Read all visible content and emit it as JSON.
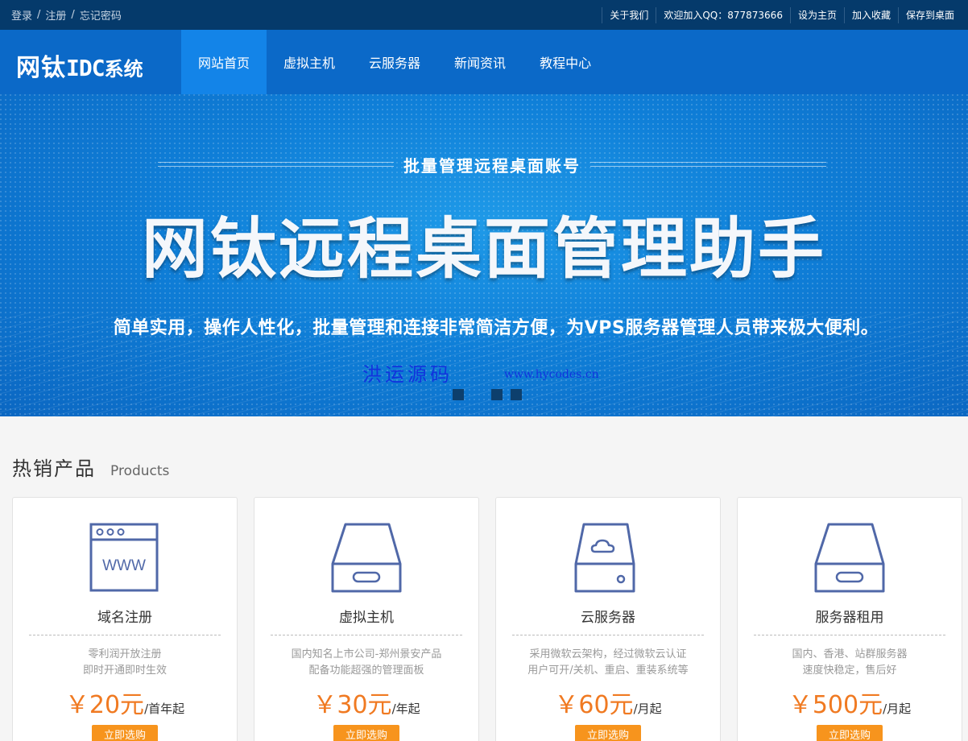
{
  "topbar": {
    "login": "登录",
    "register": "注册",
    "forgot": "忘记密码",
    "sep": "/",
    "links": [
      "关于我们",
      "欢迎加入QQ：877873666",
      "设为主页",
      "加入收藏",
      "保存到桌面"
    ]
  },
  "logo": {
    "part1": "网钛",
    "part2": "IDC",
    "part3": "系统"
  },
  "nav": [
    "网站首页",
    "虚拟主机",
    "云服务器",
    "新闻资讯",
    "教程中心"
  ],
  "banner": {
    "subtitle": "批量管理远程桌面账号",
    "headline": "网钛远程桌面管理助手",
    "description": "简单实用，操作人性化，批量管理和连接非常简洁方便，为VPS服务器管理人员带来极大便利。",
    "watermark_cn": "洪运源码",
    "watermark_url": "www.hycodes.cn"
  },
  "products": {
    "title": "热销产品",
    "subtitle": "Products",
    "items": [
      {
        "name": "域名注册",
        "desc1": "零利润开放注册",
        "desc2": "即时开通即时生效",
        "price": "￥20元",
        "unit": "/首年起",
        "button": "立即选购",
        "icon": "browser-www-icon",
        "icon_text": "WWW"
      },
      {
        "name": "虚拟主机",
        "desc1": "国内知名上市公司-郑州景安产品",
        "desc2": "配备功能超强的管理面板",
        "price": "￥30元",
        "unit": "/年起",
        "button": "立即选购",
        "icon": "hard-drive-icon"
      },
      {
        "name": "云服务器",
        "desc1": "采用微软云架构，经过微软云认证",
        "desc2": "用户可开/关机、重启、重装系统等",
        "price": "￥60元",
        "unit": "/月起",
        "button": "立即选购",
        "icon": "cloud-drive-icon"
      },
      {
        "name": "服务器租用",
        "desc1": "国内、香港、站群服务器",
        "desc2": "速度快稳定，售后好",
        "price": "￥500元",
        "unit": "/月起",
        "button": "立即选购",
        "icon": "server-drive-icon"
      }
    ]
  },
  "colors": {
    "topbar": "#053a6b",
    "nav": "#0b69c8",
    "nav_active": "#1384e8",
    "price": "#f07a22",
    "button": "#f7941d",
    "icon_stroke": "#5068a8"
  }
}
